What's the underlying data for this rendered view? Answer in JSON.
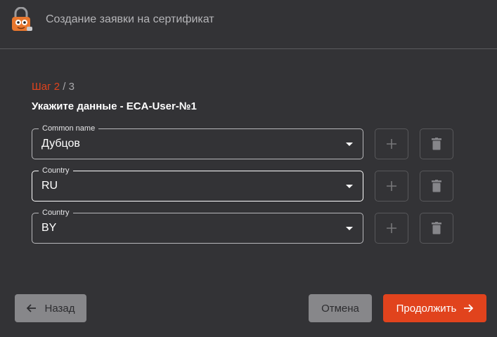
{
  "window": {
    "title": "Создание заявки на сертификат"
  },
  "step": {
    "current": "Шаг 2",
    "rest": " / 3"
  },
  "subtitle": "Укажите данные - ECA-User-№1",
  "fields": [
    {
      "label": "Common name",
      "value": "Дубцов",
      "active": false
    },
    {
      "label": "Country",
      "value": "RU",
      "active": true
    },
    {
      "label": "Country",
      "value": "BY",
      "active": false
    }
  ],
  "buttons": {
    "back": "Назад",
    "cancel": "Отмена",
    "continue": "Продолжить"
  },
  "colors": {
    "accent": "#e1431d",
    "background": "#333336",
    "secondary_button": "#87878a"
  },
  "icons": [
    "app-logo-icon",
    "plus-icon",
    "trash-icon",
    "arrow-left-icon",
    "arrow-right-icon",
    "dropdown-caret-icon"
  ]
}
